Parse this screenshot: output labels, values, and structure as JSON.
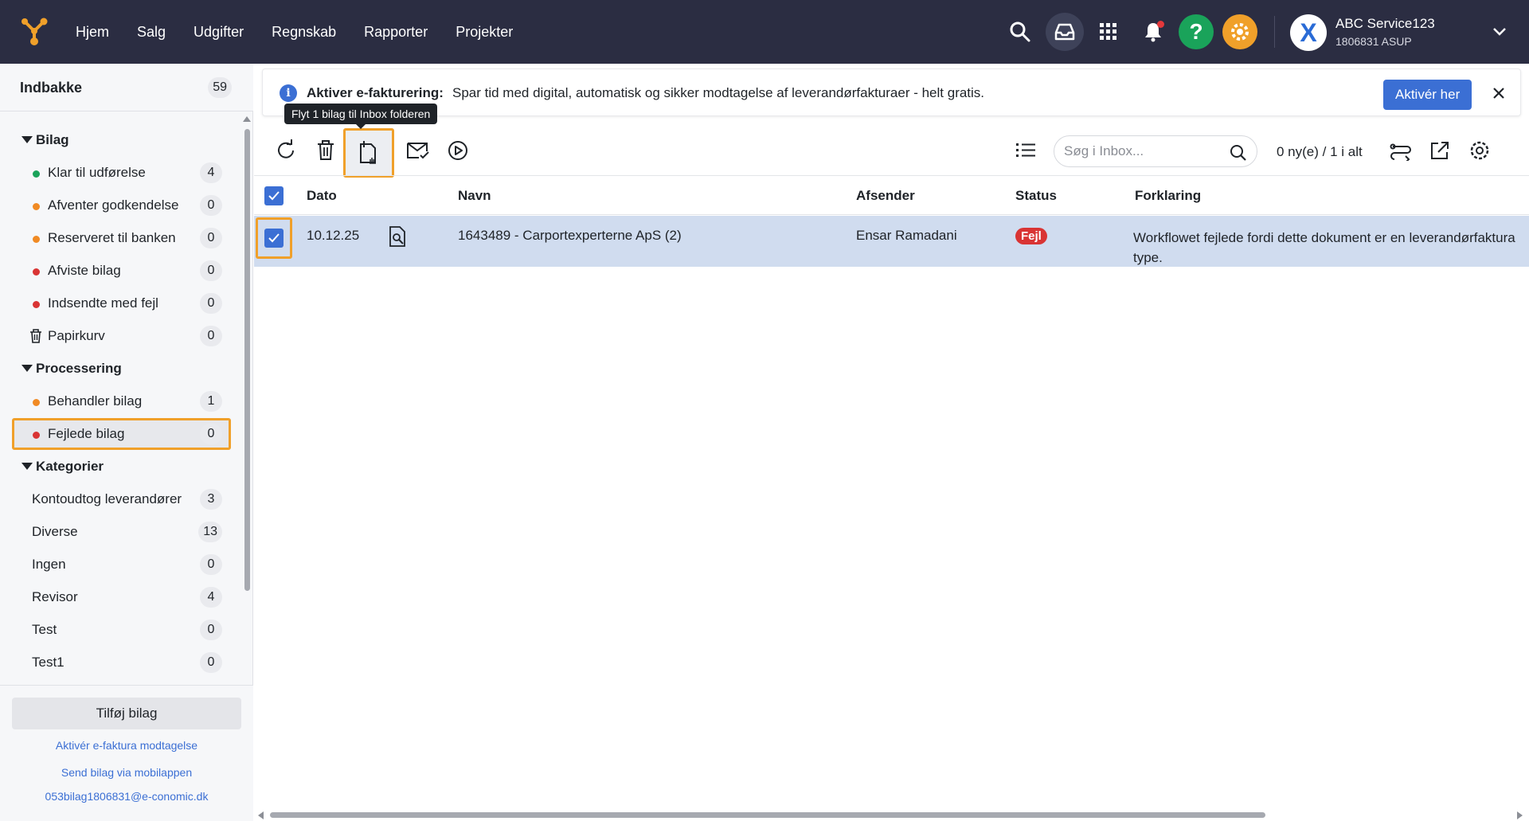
{
  "nav": {
    "items": [
      "Hjem",
      "Salg",
      "Udgifter",
      "Regnskab",
      "Rapporter",
      "Projekter"
    ]
  },
  "topbar": {
    "icons": [
      "search-icon",
      "inbox-icon",
      "apps-icon",
      "bell-icon",
      "help-icon",
      "gear-icon"
    ],
    "help_label": "?",
    "account_name": "ABC Service123",
    "account_sub": "1806831 ASUP",
    "avatar_letter": "X"
  },
  "sidebar": {
    "title": "Indbakke",
    "title_count": "59",
    "groups": [
      {
        "label": "Bilag",
        "items": [
          {
            "label": "Klar til udførelse",
            "count": "4",
            "dot": "#1aa35a"
          },
          {
            "label": "Afventer godkendelse",
            "count": "0",
            "dot": "#f08a24"
          },
          {
            "label": "Reserveret til banken",
            "count": "0",
            "dot": "#f08a24"
          },
          {
            "label": "Afviste bilag",
            "count": "0",
            "dot": "#d93434"
          },
          {
            "label": "Indsendte med fejl",
            "count": "0",
            "dot": "#d93434"
          },
          {
            "label": "Papirkurv",
            "count": "0",
            "icon": "trash-icon"
          }
        ]
      },
      {
        "label": "Processering",
        "items": [
          {
            "label": "Behandler bilag",
            "count": "1",
            "dot": "#f08a24"
          },
          {
            "label": "Fejlede bilag",
            "count": "0",
            "dot": "#d93434",
            "selected": true
          }
        ]
      },
      {
        "label": "Kategorier",
        "items": [
          {
            "label": "Kontoudtog leverandører",
            "count": "3"
          },
          {
            "label": "Diverse",
            "count": "13"
          },
          {
            "label": "Ingen",
            "count": "0"
          },
          {
            "label": "Revisor",
            "count": "4"
          },
          {
            "label": "Test",
            "count": "0"
          },
          {
            "label": "Test1",
            "count": "0"
          }
        ]
      }
    ],
    "add_button": "Tilføj bilag",
    "link_efaktura": "Aktivér e-faktura modtagelse",
    "link_mobile": "Send bilag via mobilappen",
    "link_email": "053bilag1806831@e-conomic.dk"
  },
  "banner": {
    "title": "Aktiver e-fakturering:",
    "text": "Spar tid med digital, automatisk og sikker modtagelse af leverandørfakturaer - helt gratis.",
    "button": "Aktivér her",
    "info": "i"
  },
  "toolbar": {
    "tooltip": "Flyt 1 bilag til Inbox folderen",
    "search_placeholder": "Søg i Inbox...",
    "count_text": "0 ny(e) / 1 i alt"
  },
  "table": {
    "headers": {
      "date": "Dato",
      "name": "Navn",
      "sender": "Afsender",
      "status": "Status",
      "explanation": "Forklaring"
    },
    "rows": [
      {
        "date": "10.12.25",
        "name": "1643489 - Carportexperterne ApS (2)",
        "sender": "Ensar Ramadani",
        "status": "Fejl",
        "explanation_line1": "Workflowet fejlede fordi dette dokument er en leverandørfaktura",
        "explanation_line2": "type."
      }
    ]
  },
  "colors": {
    "topbar": "#2b2d42",
    "accent": "#3b6fd4",
    "highlight": "#f0a02a",
    "error": "#d93434",
    "row_selected": "#d0dcef"
  }
}
